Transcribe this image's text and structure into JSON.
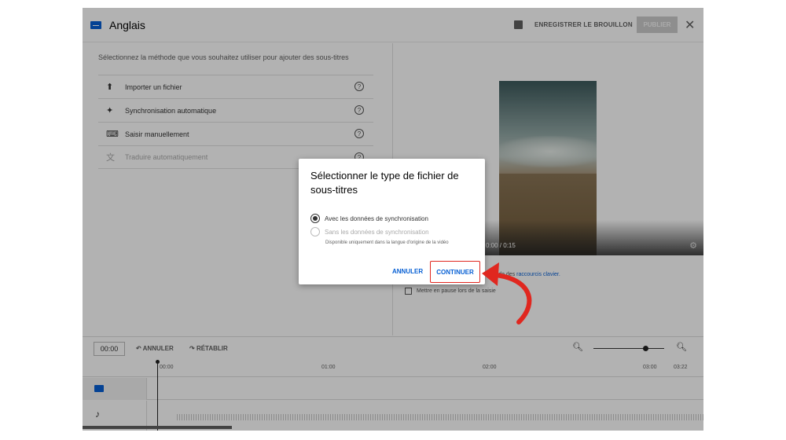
{
  "header": {
    "title": "Anglais",
    "draft_label": "ENREGISTRER LE BROUILLON",
    "publish_label": "PUBLIER",
    "close_label": "✕"
  },
  "left_panel": {
    "hint": "Sélectionnez la méthode que vous souhaitez utiliser pour ajouter des sous-titres",
    "methods": [
      {
        "label": "Importer un fichier",
        "icon": "upload-icon",
        "glyph": "⬆"
      },
      {
        "label": "Synchronisation automatique",
        "icon": "sparkle-icon",
        "glyph": "✦"
      },
      {
        "label": "Saisir manuellement",
        "icon": "keyboard-icon",
        "glyph": "⌨"
      },
      {
        "label": "Traduire automatiquement",
        "icon": "translate-icon",
        "glyph": "文"
      }
    ],
    "help_glyph": "?"
  },
  "right_panel": {
    "time": "0:00 / 0:15",
    "kbd_prefix": "à l'aide des",
    "kbd_link": "raccourcis clavier.",
    "pause_label": "Mettre en pause lors de la saisie"
  },
  "timeline": {
    "clock": "00:00",
    "undo_label": "ANNULER",
    "redo_label": "RÉTABLIR",
    "ticks": [
      "00:00",
      "01:00",
      "02:00",
      "03:00",
      "03:22"
    ]
  },
  "dialog": {
    "title": "Sélectionner le type de fichier de sous-titres",
    "option_with": "Avec les données de synchronisation",
    "option_without": "Sans les données de synchronisation",
    "option_without_note": "Disponible uniquement dans la langue d'origine de la vidéo",
    "cancel_label": "ANNULER",
    "continue_label": "CONTINUER",
    "selected_option": "Avec les données de synchronisation"
  },
  "colors": {
    "accent_blue": "#065fd4",
    "highlight_red": "#e0271f",
    "overlay": "rgba(0,0,0,0.30)"
  }
}
